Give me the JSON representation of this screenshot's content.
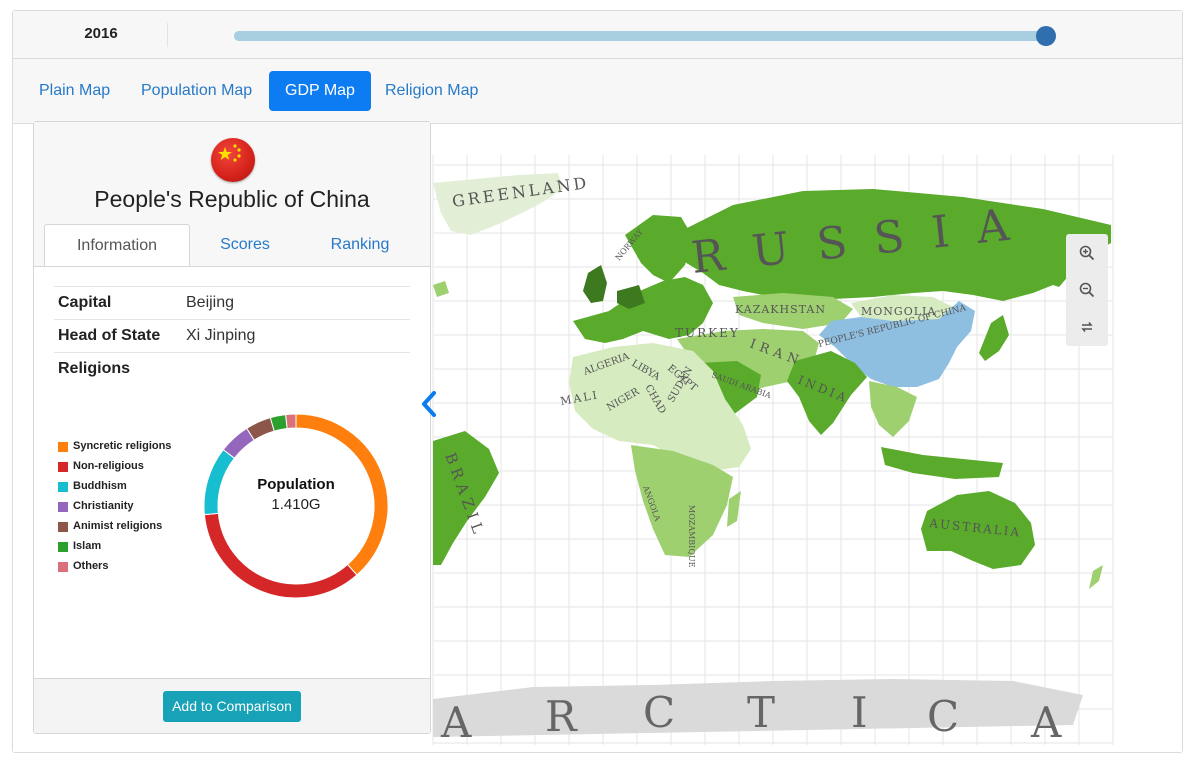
{
  "timeline": {
    "year": "2016",
    "progress": 1.0
  },
  "map_tabs": [
    {
      "label": "Plain Map",
      "active": false
    },
    {
      "label": "Population Map",
      "active": false
    },
    {
      "label": "GDP Map",
      "active": true
    },
    {
      "label": "Religion Map",
      "active": false
    }
  ],
  "map": {
    "labels": [
      "GREENLAND",
      "RUSSIA",
      "KAZAKHSTAN",
      "MONGOLIA",
      "PEOPLE'S REPUBLIC OF CHINA",
      "INDIA",
      "IRAN",
      "TURKEY",
      "ALGERIA",
      "LIBYA",
      "EGYPT",
      "MALI",
      "NIGER",
      "CHAD",
      "SUDAN",
      "SAUDI ARABIA",
      "ANGOLA",
      "MOZAMBIQUE",
      "BRAZIL",
      "AUSTRALIA",
      "ANTARCTICA",
      "NORWAY"
    ],
    "antarctica_letters": [
      "A",
      "R",
      "C",
      "T",
      "I",
      "C",
      "A"
    ],
    "colors": {
      "land_light": "#d6ebc0",
      "land_mid": "#9fd070",
      "land_dark": "#5aaa2c",
      "land_darkest": "#3d7a1f",
      "selected": "#8fbfe0",
      "no_data": "#dadada",
      "grid": "#e6e6e6"
    },
    "controls": {
      "zoom_in_icon": "zoom-in-icon",
      "zoom_out_icon": "zoom-out-icon",
      "reset_icon": "reset-icon"
    }
  },
  "country_panel": {
    "flag_icon": "china-flag-icon",
    "name": "People's Republic of China",
    "tabs": [
      {
        "label": "Information",
        "active": true
      },
      {
        "label": "Scores",
        "active": false
      },
      {
        "label": "Ranking",
        "active": false
      }
    ],
    "info": {
      "capital_label": "Capital",
      "capital_value": "Beijing",
      "head_label": "Head of State",
      "head_value": "Xi Jinping",
      "religions_label": "Religions"
    },
    "religion_chart": {
      "center_title": "Population",
      "center_value": "1.410G"
    },
    "compare_button": "Add to Comparison",
    "collapse_icon": "chevron-left-icon"
  },
  "chart_data": {
    "type": "pie",
    "title": "",
    "labels": [
      "Syncretic religions",
      "Non-religious",
      "Buddhism",
      "Christianity",
      "Animist religions",
      "Islam",
      "Others"
    ],
    "values": [
      38.5,
      35.0,
      12.0,
      5.5,
      4.5,
      2.7,
      1.8
    ],
    "colors": [
      "#ff7f0e",
      "#d62728",
      "#17becf",
      "#9467bd",
      "#8c564b",
      "#2ca02c",
      "#d9707a"
    ],
    "legend_position": "left"
  }
}
